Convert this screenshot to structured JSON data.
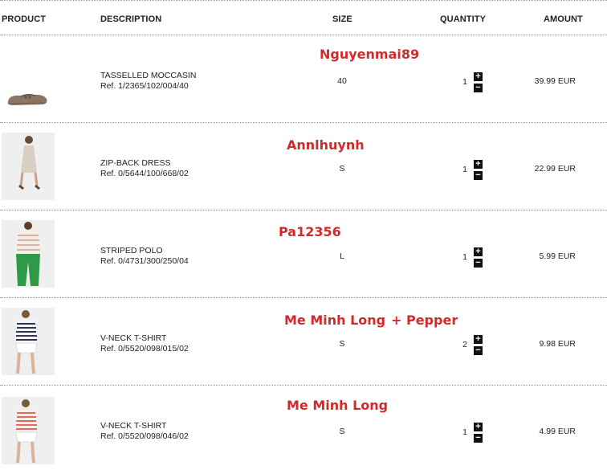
{
  "columns": {
    "product": "PRODUCT",
    "description": "DESCRIPTION",
    "size": "SIZE",
    "quantity": "QUANTITY",
    "amount": "AMOUNT"
  },
  "controls": {
    "plus": "+",
    "minus": "−"
  },
  "items": [
    {
      "name": "TASSELLED MOCCASIN",
      "ref": "Ref. 1/2365/102/004/40",
      "size": "40",
      "quantity": "1",
      "amount": "39.99 EUR",
      "note": "Nguyenmai89",
      "note2": ""
    },
    {
      "name": "ZIP-BACK DRESS",
      "ref": "Ref. 0/5644/100/668/02",
      "size": "S",
      "quantity": "1",
      "amount": "22.99 EUR",
      "note": "Annlhuynh",
      "note2": ""
    },
    {
      "name": "STRIPED POLO",
      "ref": "Ref. 0/4731/300/250/04",
      "size": "L",
      "quantity": "1",
      "amount": "5.99 EUR",
      "note": "Pa12356",
      "note2": ""
    },
    {
      "name": "V-NECK T-SHIRT",
      "ref": "Ref. 0/5520/098/015/02",
      "size": "S",
      "quantity": "2",
      "amount": "9.98 EUR",
      "note": "Me Minh Long",
      "note2": "+ Pepper"
    },
    {
      "name": "V-NECK T-SHIRT",
      "ref": "Ref. 0/5520/098/046/02",
      "size": "S",
      "quantity": "1",
      "amount": "4.99 EUR",
      "note": "Me Minh Long",
      "note2": ""
    }
  ],
  "colors": {
    "annotation": "#d02b2b",
    "button": "#111111",
    "divider": "#9a9a9a"
  }
}
